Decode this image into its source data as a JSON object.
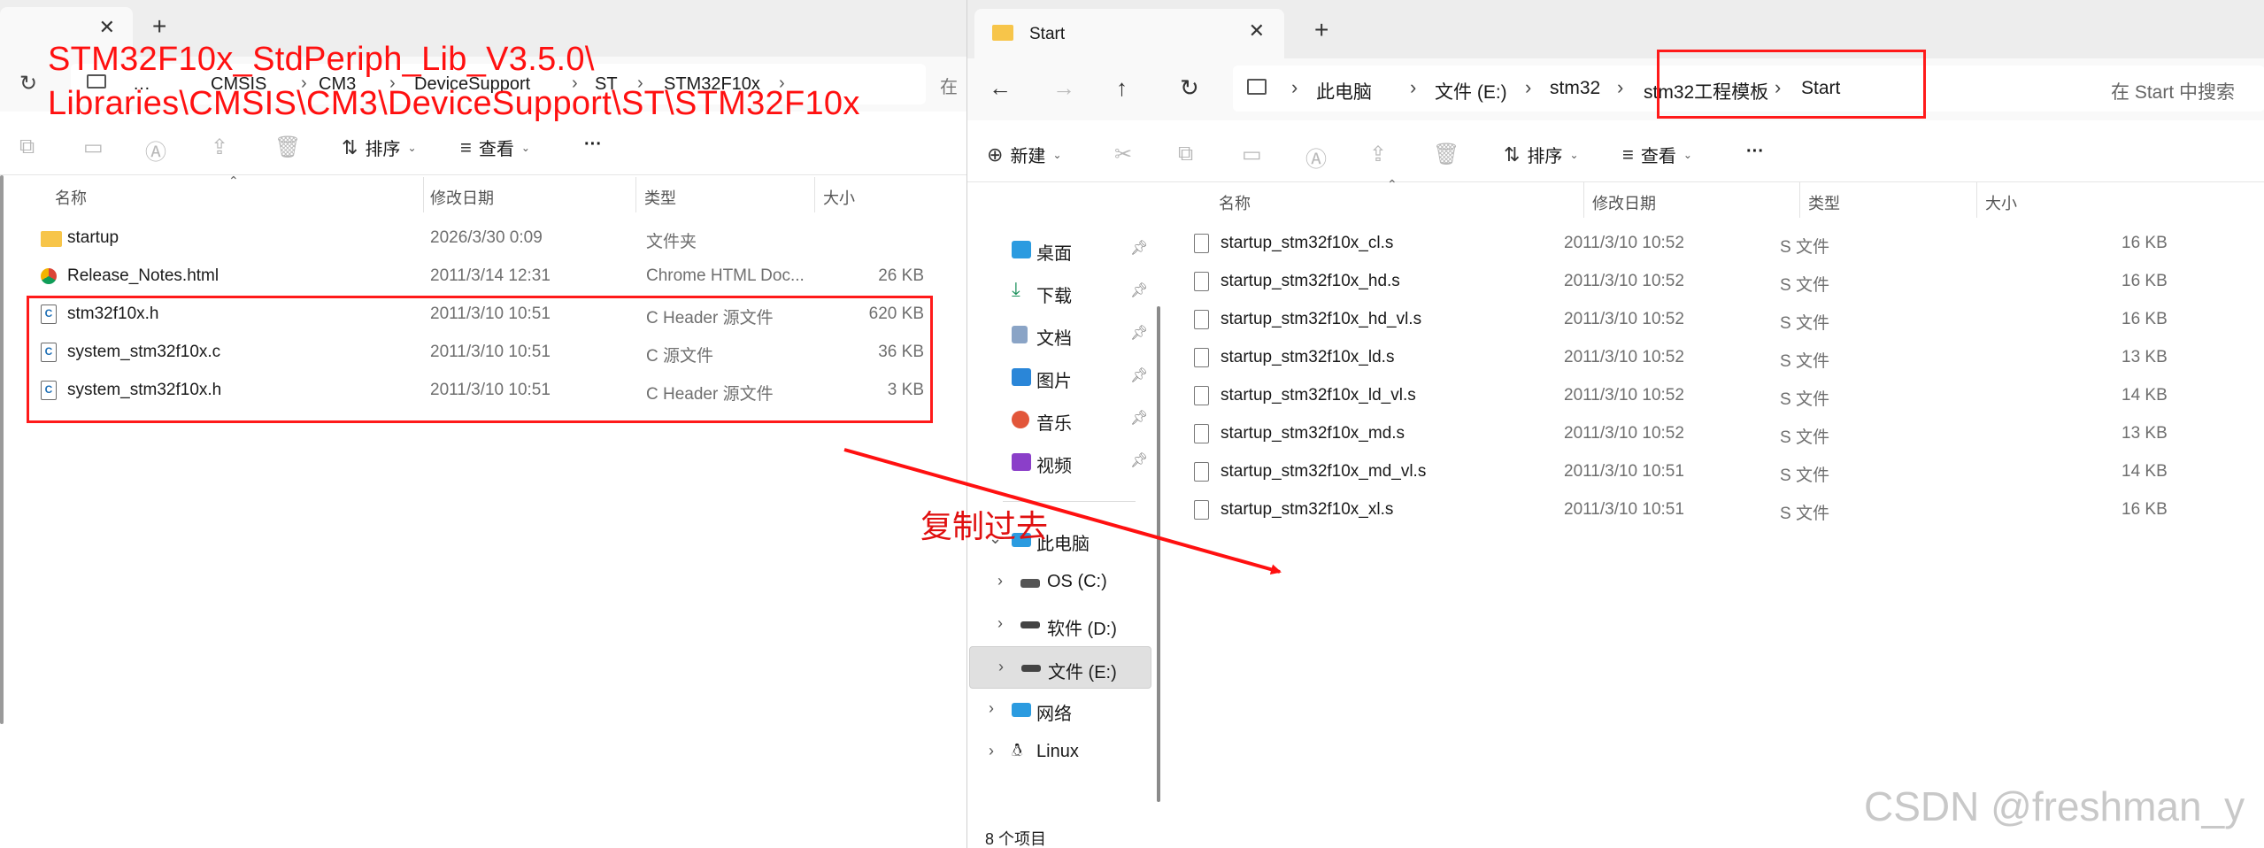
{
  "annotation": {
    "path_line1": "STM32F10x_StdPeriph_Lib_V3.5.0\\",
    "path_line2": "Libraries\\CMSIS\\CM3\\DeviceSupport\\ST\\STM32F10x",
    "copy_label": "复制过去",
    "watermark": "CSDN @freshman_y",
    "color": "#ff1a1a"
  },
  "left_window": {
    "breadcrumb": [
      "…",
      "CMSIS",
      "CM3",
      "DeviceSupport",
      "ST",
      "STM32F10x"
    ],
    "search_cut": "在",
    "toolbar": {
      "sort_label": "排序",
      "view_label": "查看",
      "more_label": "···"
    },
    "columns": {
      "name": "名称",
      "date": "修改日期",
      "type": "类型",
      "size": "大小"
    },
    "files": [
      {
        "name": "startup",
        "date": "2026/3/30 0:09",
        "type": "文件夹",
        "size": "",
        "icon": "folder-icon"
      },
      {
        "name": "Release_Notes.html",
        "date": "2011/3/14 12:31",
        "type": "Chrome HTML Doc...",
        "size": "26 KB",
        "icon": "chrome-html-icon"
      },
      {
        "name": "stm32f10x.h",
        "date": "2011/3/10 10:51",
        "type": "C Header 源文件",
        "size": "620 KB",
        "icon": "c-file-icon"
      },
      {
        "name": "system_stm32f10x.c",
        "date": "2011/3/10 10:51",
        "type": "C 源文件",
        "size": "36 KB",
        "icon": "c-file-icon"
      },
      {
        "name": "system_stm32f10x.h",
        "date": "2011/3/10 10:51",
        "type": "C Header 源文件",
        "size": "3 KB",
        "icon": "c-file-icon"
      }
    ]
  },
  "right_window": {
    "tab_title": "Start",
    "breadcrumb": [
      "此电脑",
      "文件 (E:)",
      "stm32",
      "stm32工程模板",
      "Start"
    ],
    "search_placeholder": "在 Start 中搜索",
    "toolbar": {
      "new_label": "新建",
      "sort_label": "排序",
      "view_label": "查看",
      "more_label": "···"
    },
    "columns": {
      "name": "名称",
      "date": "修改日期",
      "type": "类型",
      "size": "大小"
    },
    "nav": [
      {
        "label": "桌面",
        "icon": "desktop-icon",
        "color": "#2b9be0"
      },
      {
        "label": "下载",
        "icon": "download-icon",
        "color": "#1a8f5a"
      },
      {
        "label": "文档",
        "icon": "document-icon",
        "color": "#5a7da8"
      },
      {
        "label": "图片",
        "icon": "pictures-icon",
        "color": "#2a86d8"
      },
      {
        "label": "音乐",
        "icon": "music-icon",
        "color": "#e2563a"
      },
      {
        "label": "视频",
        "icon": "videos-icon",
        "color": "#8b3fc9"
      },
      {
        "label": "此电脑",
        "icon": "this-pc-icon",
        "color": "#2b9be0"
      },
      {
        "label": "OS (C:)",
        "icon": "drive-c-icon",
        "color": "#555555"
      },
      {
        "label": "软件 (D:)",
        "icon": "drive-d-icon",
        "color": "#444444"
      },
      {
        "label": "文件 (E:)",
        "icon": "drive-e-icon",
        "color": "#444444"
      },
      {
        "label": "网络",
        "icon": "network-icon",
        "color": "#2b9be0"
      },
      {
        "label": "Linux",
        "icon": "linux-icon",
        "color": "#222222"
      }
    ],
    "files": [
      {
        "name": "startup_stm32f10x_cl.s",
        "date": "2011/3/10 10:52",
        "type": "S 文件",
        "size": "16 KB"
      },
      {
        "name": "startup_stm32f10x_hd.s",
        "date": "2011/3/10 10:52",
        "type": "S 文件",
        "size": "16 KB"
      },
      {
        "name": "startup_stm32f10x_hd_vl.s",
        "date": "2011/3/10 10:52",
        "type": "S 文件",
        "size": "16 KB"
      },
      {
        "name": "startup_stm32f10x_ld.s",
        "date": "2011/3/10 10:52",
        "type": "S 文件",
        "size": "13 KB"
      },
      {
        "name": "startup_stm32f10x_ld_vl.s",
        "date": "2011/3/10 10:52",
        "type": "S 文件",
        "size": "14 KB"
      },
      {
        "name": "startup_stm32f10x_md.s",
        "date": "2011/3/10 10:52",
        "type": "S 文件",
        "size": "13 KB"
      },
      {
        "name": "startup_stm32f10x_md_vl.s",
        "date": "2011/3/10 10:51",
        "type": "S 文件",
        "size": "14 KB"
      },
      {
        "name": "startup_stm32f10x_xl.s",
        "date": "2011/3/10 10:51",
        "type": "S 文件",
        "size": "16 KB"
      }
    ],
    "status": "8 个项目"
  }
}
